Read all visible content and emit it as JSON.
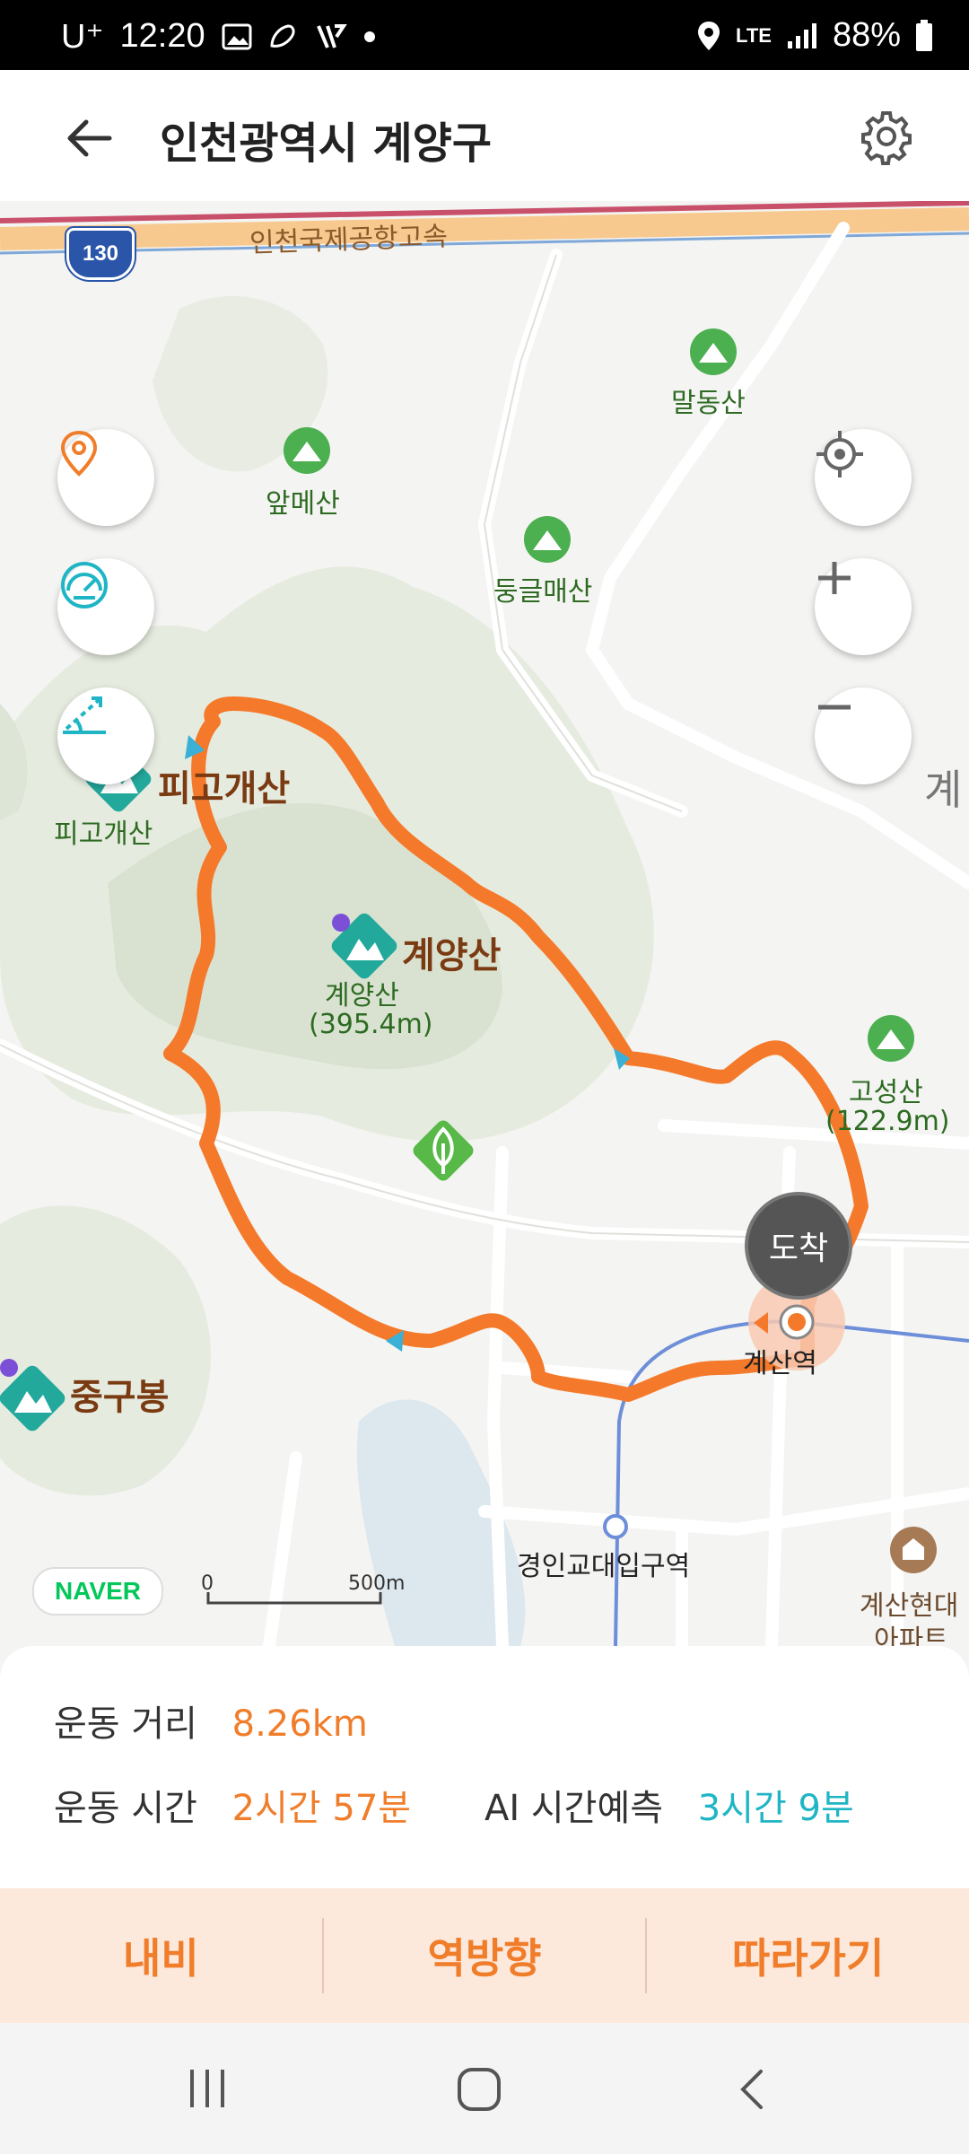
{
  "status_bar": {
    "carrier": "U⁺",
    "time": "12:20",
    "network": "LTE",
    "battery": "88%"
  },
  "header": {
    "title": "인천광역시 계양구"
  },
  "map": {
    "highway_name": "인천국제공항고속",
    "highway_number": "130",
    "peaks": {
      "maldongsan": "말동산",
      "apmesan": "앞메산",
      "dunggeulmaesan": "둥글매산",
      "pigogaesan_marker": "피고개산",
      "pigogaesan_small": "피고개산",
      "gyeyangsan_marker": "계양산",
      "gyeyangsan_small": "계양산",
      "gyeyangsan_height": "(395.4m)",
      "goseongsan": "고성산",
      "goseongsan_height": "(122.9m)",
      "junggubong": "중구봉"
    },
    "places": {
      "edge_text": "계",
      "arrival": "도착",
      "gyesan_station": "계산역",
      "gyeongin_station": "경인교대입구역",
      "apartment_line1": "계산현대",
      "apartment_line2": "아파트"
    },
    "naver_logo": "NAVER",
    "scale": {
      "start": "0",
      "end": "500m"
    },
    "route_color": "#f5792a"
  },
  "stats": {
    "distance_label": "운동 거리",
    "distance_value": "8.26km",
    "time_label": "운동 시간",
    "time_value": "2시간 57분",
    "ai_label": "AI 시간예측",
    "ai_value": "3시간 9분"
  },
  "actions": {
    "navi": "내비",
    "reverse": "역방향",
    "follow": "따라가기"
  },
  "colors": {
    "accent_orange": "#f07d2a",
    "accent_teal": "#1fb5c5",
    "action_bg": "#fde8dc"
  }
}
